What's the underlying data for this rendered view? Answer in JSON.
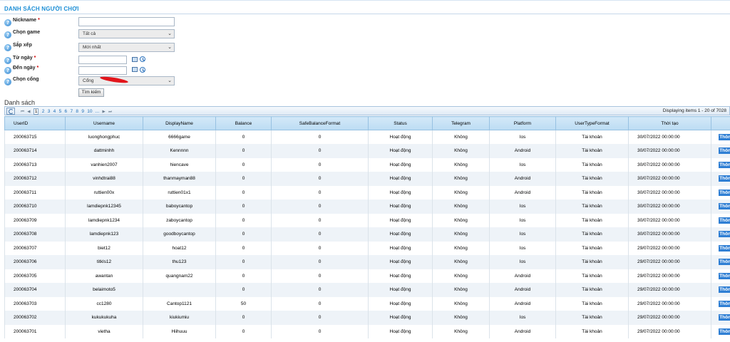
{
  "header": {
    "title": "DANH SÁCH NGƯỜI CHƠI"
  },
  "form": {
    "nickname_label": "Nickname",
    "required_mark": "*",
    "game_label": "Chọn game",
    "game_value": "Tất cả",
    "sort_label": "Sắp xếp",
    "sort_value": "Mới nhất",
    "from_date_label": "Từ ngày",
    "to_date_label": "Đến ngày",
    "portal_label": "Chọn cổng",
    "portal_value": "Cổng",
    "search_button": "Tìm kiếm",
    "help_glyph": "?"
  },
  "list": {
    "title": "Danh sách",
    "pager": {
      "first": "⏮",
      "prev": "◀",
      "pages": [
        "1",
        "2",
        "3",
        "4",
        "5",
        "6",
        "7",
        "8",
        "9",
        "10",
        "..."
      ],
      "next": "▶",
      "last": "⏭",
      "current": "1"
    },
    "display_info": "Displaying items 1 - 20 of 7028"
  },
  "table": {
    "columns": [
      "UserID",
      "Username",
      "DisplayName",
      "Balance",
      "SafeBalanceFormat",
      "Status",
      "Telegram",
      "Platform",
      "UserTypeFormat",
      "Thời tạo",
      ""
    ],
    "rows": [
      {
        "id": "200063715",
        "username": "luonghongphuc",
        "display": "6666game",
        "balance": "0",
        "safe": "0",
        "status": "Hoạt động",
        "telegram": "Không",
        "platform": "Ios",
        "type": "Tài khoản",
        "created": "30/07/2022 00:00:00",
        "action": "Thông tin"
      },
      {
        "id": "200063714",
        "username": "dattminhh",
        "display": "Kennnnn",
        "balance": "0",
        "safe": "0",
        "status": "Hoạt động",
        "telegram": "Không",
        "platform": "Android",
        "type": "Tài khoản",
        "created": "30/07/2022 00:00:00",
        "action": "Thông tin"
      },
      {
        "id": "200063713",
        "username": "vanhien2007",
        "display": "hiencave",
        "balance": "0",
        "safe": "0",
        "status": "Hoạt động",
        "telegram": "Không",
        "platform": "Ios",
        "type": "Tài khoản",
        "created": "30/07/2022 00:00:00",
        "action": "Thông tin"
      },
      {
        "id": "200063712",
        "username": "vinhdtrai88",
        "display": "thanmayman88",
        "balance": "0",
        "safe": "0",
        "status": "Hoạt động",
        "telegram": "Không",
        "platform": "Android",
        "type": "Tài khoản",
        "created": "30/07/2022 00:00:00",
        "action": "Thông tin"
      },
      {
        "id": "200063711",
        "username": "ruttien00x",
        "display": "ruttien01x1",
        "balance": "0",
        "safe": "0",
        "status": "Hoạt động",
        "telegram": "Không",
        "platform": "Android",
        "type": "Tài khoản",
        "created": "30/07/2022 00:00:00",
        "action": "Thông tin"
      },
      {
        "id": "200063710",
        "username": "lamdiepnk12345",
        "display": "baboycantop",
        "balance": "0",
        "safe": "0",
        "status": "Hoạt động",
        "telegram": "Không",
        "platform": "Ios",
        "type": "Tài khoản",
        "created": "30/07/2022 00:00:00",
        "action": "Thông tin"
      },
      {
        "id": "200063709",
        "username": "lamdiepnk1234",
        "display": "zaboycantop",
        "balance": "0",
        "safe": "0",
        "status": "Hoạt động",
        "telegram": "Không",
        "platform": "Ios",
        "type": "Tài khoản",
        "created": "30/07/2022 00:00:00",
        "action": "Thông tin"
      },
      {
        "id": "200063708",
        "username": "lamdiepnk123",
        "display": "goodboycantop",
        "balance": "0",
        "safe": "0",
        "status": "Hoạt động",
        "telegram": "Không",
        "platform": "Ios",
        "type": "Tài khoản",
        "created": "30/07/2022 00:00:00",
        "action": "Thông tin"
      },
      {
        "id": "200063707",
        "username": "biet12",
        "display": "hoat12",
        "balance": "0",
        "safe": "0",
        "status": "Hoạt động",
        "telegram": "Không",
        "platform": "Ios",
        "type": "Tài khoản",
        "created": "29/07/2022 00:00:00",
        "action": "Thông tin"
      },
      {
        "id": "200063706",
        "username": "titkls12",
        "display": "thu123",
        "balance": "0",
        "safe": "0",
        "status": "Hoạt động",
        "telegram": "Không",
        "platform": "Ios",
        "type": "Tài khoản",
        "created": "29/07/2022 00:00:00",
        "action": "Thông tin"
      },
      {
        "id": "200063705",
        "username": "awantan",
        "display": "quangnam22",
        "balance": "0",
        "safe": "0",
        "status": "Hoạt động",
        "telegram": "Không",
        "platform": "Android",
        "type": "Tài khoản",
        "created": "29/07/2022 00:00:00",
        "action": "Thông tin"
      },
      {
        "id": "200063704",
        "username": "belaimoto5",
        "display": "",
        "balance": "0",
        "safe": "0",
        "status": "Hoạt động",
        "telegram": "Không",
        "platform": "Android",
        "type": "Tài khoản",
        "created": "29/07/2022 00:00:00",
        "action": "Thông tin"
      },
      {
        "id": "200063703",
        "username": "cc1280",
        "display": "Cantop1121",
        "balance": "50",
        "safe": "0",
        "status": "Hoạt động",
        "telegram": "Không",
        "platform": "Android",
        "type": "Tài khoản",
        "created": "29/07/2022 00:00:00",
        "action": "Thông tin"
      },
      {
        "id": "200063702",
        "username": "kukukukuha",
        "display": "kiukiumiu",
        "balance": "0",
        "safe": "0",
        "status": "Hoạt động",
        "telegram": "Không",
        "platform": "Ios",
        "type": "Tài khoản",
        "created": "29/07/2022 00:00:00",
        "action": "Thông tin"
      },
      {
        "id": "200063701",
        "username": "vietha",
        "display": "Hiihuuu",
        "balance": "0",
        "safe": "0",
        "status": "Hoạt động",
        "telegram": "Không",
        "platform": "Android",
        "type": "Tài khoản",
        "created": "29/07/2022 00:00:00",
        "action": "Thông tin"
      }
    ]
  }
}
